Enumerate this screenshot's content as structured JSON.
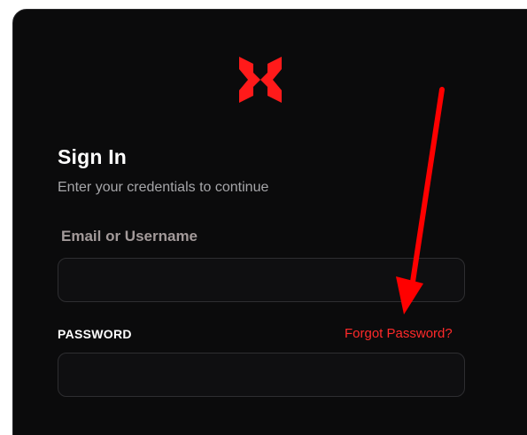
{
  "brand": {
    "logo_icon": "x-logo-icon",
    "accent_color": "#ff1a1a"
  },
  "signin": {
    "title": "Sign In",
    "subtitle": "Enter your credentials to continue",
    "email_label": "Email or Username",
    "email_value": "",
    "email_placeholder": "",
    "password_label": "PASSWORD",
    "password_value": "",
    "password_placeholder": "",
    "forgot_label": "Forgot Password?"
  },
  "annotation": {
    "arrow_icon": "red-arrow-icon",
    "color": "#ff0000"
  }
}
